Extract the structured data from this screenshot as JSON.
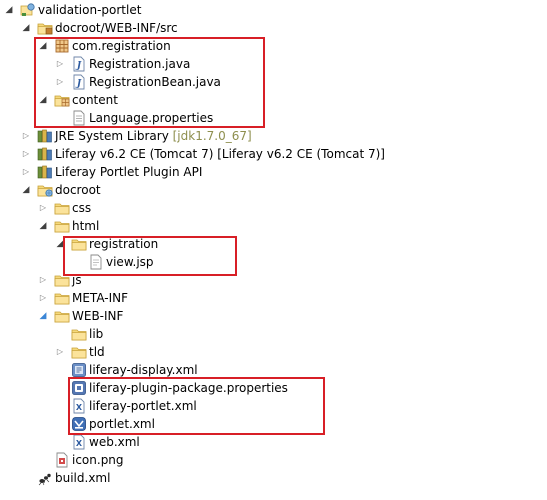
{
  "tree": [
    {
      "depth": 0,
      "twisty": "open",
      "icon": "project",
      "label": "validation-portlet"
    },
    {
      "depth": 1,
      "twisty": "open",
      "icon": "src-folder",
      "label": "docroot/WEB-INF/src"
    },
    {
      "depth": 2,
      "twisty": "open",
      "icon": "package",
      "label": "com.registration"
    },
    {
      "depth": 3,
      "twisty": "closed",
      "icon": "java-file",
      "label": "Registration.java"
    },
    {
      "depth": 3,
      "twisty": "closed",
      "icon": "java-file",
      "label": "RegistrationBean.java"
    },
    {
      "depth": 2,
      "twisty": "open",
      "icon": "package-folder",
      "label": "content"
    },
    {
      "depth": 3,
      "twisty": "none",
      "icon": "properties-file",
      "label": "Language.properties"
    },
    {
      "depth": 1,
      "twisty": "closed",
      "icon": "library",
      "label": "JRE System Library",
      "decoration": "[jdk1.7.0_67]"
    },
    {
      "depth": 1,
      "twisty": "closed",
      "icon": "library",
      "label": "Liferay v6.2 CE (Tomcat 7) [Liferay v6.2 CE (Tomcat 7)]"
    },
    {
      "depth": 1,
      "twisty": "closed",
      "icon": "library",
      "label": "Liferay Portlet Plugin API"
    },
    {
      "depth": 1,
      "twisty": "open",
      "icon": "web-folder",
      "label": "docroot"
    },
    {
      "depth": 2,
      "twisty": "closed",
      "icon": "folder",
      "label": "css"
    },
    {
      "depth": 2,
      "twisty": "open",
      "icon": "folder",
      "label": "html"
    },
    {
      "depth": 3,
      "twisty": "open",
      "icon": "folder",
      "label": "registration"
    },
    {
      "depth": 4,
      "twisty": "none",
      "icon": "jsp-file",
      "label": "view.jsp"
    },
    {
      "depth": 2,
      "twisty": "closed",
      "icon": "folder",
      "label": "js"
    },
    {
      "depth": 2,
      "twisty": "closed",
      "icon": "folder",
      "label": "META-INF"
    },
    {
      "depth": 2,
      "twisty": "open-blue",
      "icon": "folder",
      "label": "WEB-INF"
    },
    {
      "depth": 3,
      "twisty": "none",
      "icon": "folder",
      "label": "lib"
    },
    {
      "depth": 3,
      "twisty": "closed",
      "icon": "folder",
      "label": "tld"
    },
    {
      "depth": 3,
      "twisty": "none",
      "icon": "liferay-xml",
      "label": "liferay-display.xml"
    },
    {
      "depth": 3,
      "twisty": "none",
      "icon": "liferay-package",
      "label": "liferay-plugin-package.properties"
    },
    {
      "depth": 3,
      "twisty": "none",
      "icon": "xml-file",
      "label": "liferay-portlet.xml"
    },
    {
      "depth": 3,
      "twisty": "none",
      "icon": "portlet-xml",
      "label": "portlet.xml"
    },
    {
      "depth": 3,
      "twisty": "none",
      "icon": "xml-file",
      "label": "web.xml"
    },
    {
      "depth": 2,
      "twisty": "none",
      "icon": "png-file",
      "label": "icon.png"
    },
    {
      "depth": 1,
      "twisty": "none",
      "icon": "ant-file",
      "label": "build.xml"
    }
  ],
  "colors": {
    "highlight": "#d81f26",
    "decoration": "#8e8f4e",
    "folder": "#e8c25a"
  }
}
